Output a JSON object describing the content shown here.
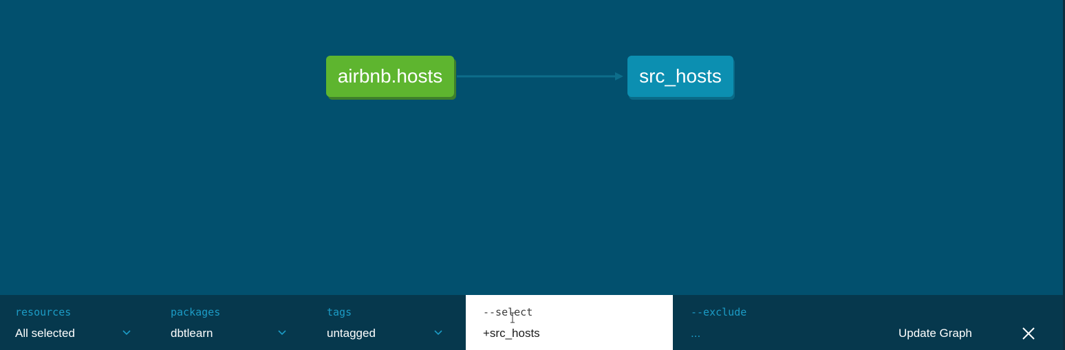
{
  "graph": {
    "nodes": [
      {
        "id": "airbnb.hosts",
        "label": "airbnb.hosts",
        "kind": "source",
        "color": "#5eb52f"
      },
      {
        "id": "src_hosts",
        "label": "src_hosts",
        "kind": "model",
        "color": "#0c8fb1"
      }
    ],
    "edges": [
      {
        "from": "airbnb.hosts",
        "to": "src_hosts"
      }
    ]
  },
  "filters": {
    "resources": {
      "label": "resources",
      "value": "All selected"
    },
    "packages": {
      "label": "packages",
      "value": "dbtlearn"
    },
    "tags": {
      "label": "tags",
      "value": "untagged"
    },
    "select": {
      "label": "--select",
      "value": "+src_hosts"
    },
    "exclude": {
      "label": "--exclude",
      "placeholder": "..."
    }
  },
  "actions": {
    "update_graph_label": "Update Graph",
    "close_icon": "close-icon"
  },
  "colors": {
    "canvas": "#02506e",
    "filter_bar": "#06384d",
    "accent": "#1c9cc6",
    "source_node": "#5eb52f",
    "model_node": "#0c8fb1"
  }
}
